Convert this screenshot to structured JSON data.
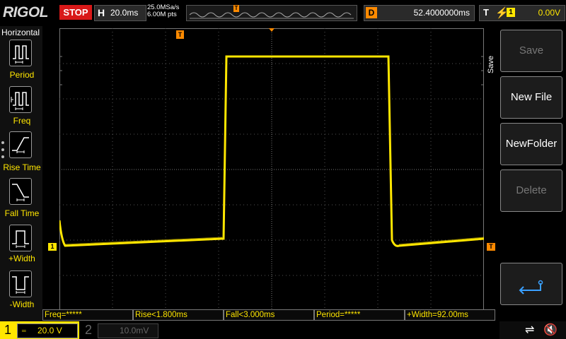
{
  "header": {
    "brand": "RIGOL",
    "run_state": "STOP",
    "horizontal_label": "H",
    "timebase": "20.0ms",
    "sample_rate": "25.0MSa/s",
    "memory_depth": "6.00M pts",
    "delay_label": "D",
    "delay_value": "52.4000000ms",
    "trigger_label": "T",
    "trigger_edge_icon": "rising-edge-icon",
    "trigger_source": "1",
    "trigger_level": "0.00V"
  },
  "left_menu": {
    "title": "Horizontal",
    "items": [
      {
        "label": "Period",
        "icon": "period-icon"
      },
      {
        "label": "Freq",
        "icon": "frequency-icon"
      },
      {
        "label": "Rise Time",
        "icon": "rise-time-icon"
      },
      {
        "label": "Fall Time",
        "icon": "fall-time-icon"
      },
      {
        "label": "+Width",
        "icon": "positive-width-icon"
      },
      {
        "label": "-Width",
        "icon": "negative-width-icon"
      }
    ]
  },
  "right_menu": {
    "section": "Save",
    "items": [
      {
        "label": "Save",
        "enabled": false
      },
      {
        "label": "New File",
        "enabled": true
      },
      {
        "label": "NewFolder",
        "enabled": true
      },
      {
        "label": "Delete",
        "enabled": false
      }
    ],
    "return_icon": "return-arrow-icon"
  },
  "markers": {
    "ch1_ground": "1",
    "trigger_level": "T",
    "trigger_position": "T"
  },
  "measurements": [
    "Freq=*****",
    "Rise<1.800ms",
    "Fall<3.000ms",
    "Period=*****",
    "+Width=92.00ms"
  ],
  "channels": {
    "ch1": {
      "number": "1",
      "scale": "20.0 V",
      "color": "#ffe600"
    },
    "ch2": {
      "number": "2",
      "scale": "10.0mV",
      "color": "#666666"
    }
  },
  "status_icons": [
    "usb-icon",
    "sound-muted-icon"
  ],
  "colors": {
    "trace": "#ffe600",
    "trigger": "#ff8a00",
    "stop": "#d81818"
  }
}
